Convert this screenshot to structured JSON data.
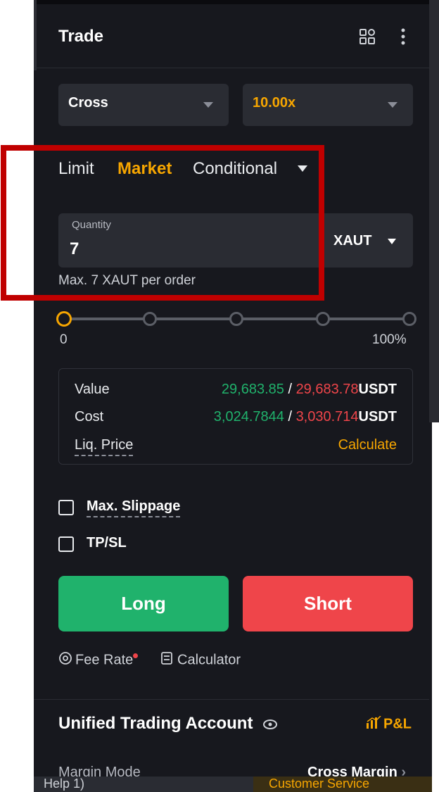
{
  "header": {
    "title": "Trade"
  },
  "margin_mode": {
    "value": "Cross"
  },
  "leverage": {
    "value": "10.00x"
  },
  "order_tabs": {
    "limit": "Limit",
    "market": "Market",
    "conditional": "Conditional"
  },
  "quantity": {
    "label": "Quantity",
    "value": "7",
    "unit": "XAUT",
    "max_note": "Max. 7 XAUT per order"
  },
  "slider": {
    "min_label": "0",
    "max_label": "100%",
    "position": 0
  },
  "info": {
    "value_label": "Value",
    "value_long": "29,683.85",
    "value_sep": " / ",
    "value_short": "29,683.78",
    "value_unit": "USDT",
    "cost_label": "Cost",
    "cost_long": "3,024.7844",
    "cost_sep": " / ",
    "cost_short": "3,030.714",
    "cost_unit": "USDT",
    "liq_label": "Liq. Price",
    "liq_action": "Calculate"
  },
  "options": {
    "max_slippage": "Max. Slippage",
    "tpsl": "TP/SL"
  },
  "actions": {
    "long": "Long",
    "short": "Short"
  },
  "footer": {
    "fee_rate": "Fee Rate",
    "calculator": "Calculator"
  },
  "account": {
    "title": "Unified Trading Account",
    "pnl": "P&L",
    "margin_mode_label": "Margin Mode",
    "margin_mode_value": "Cross Margin"
  },
  "bottom_bar": {
    "left": "Help 1)",
    "right": "Customer Service"
  },
  "colors": {
    "accent": "#f7a600",
    "long": "#20b26c",
    "short": "#ef454a",
    "highlight_box": "#c00000"
  }
}
